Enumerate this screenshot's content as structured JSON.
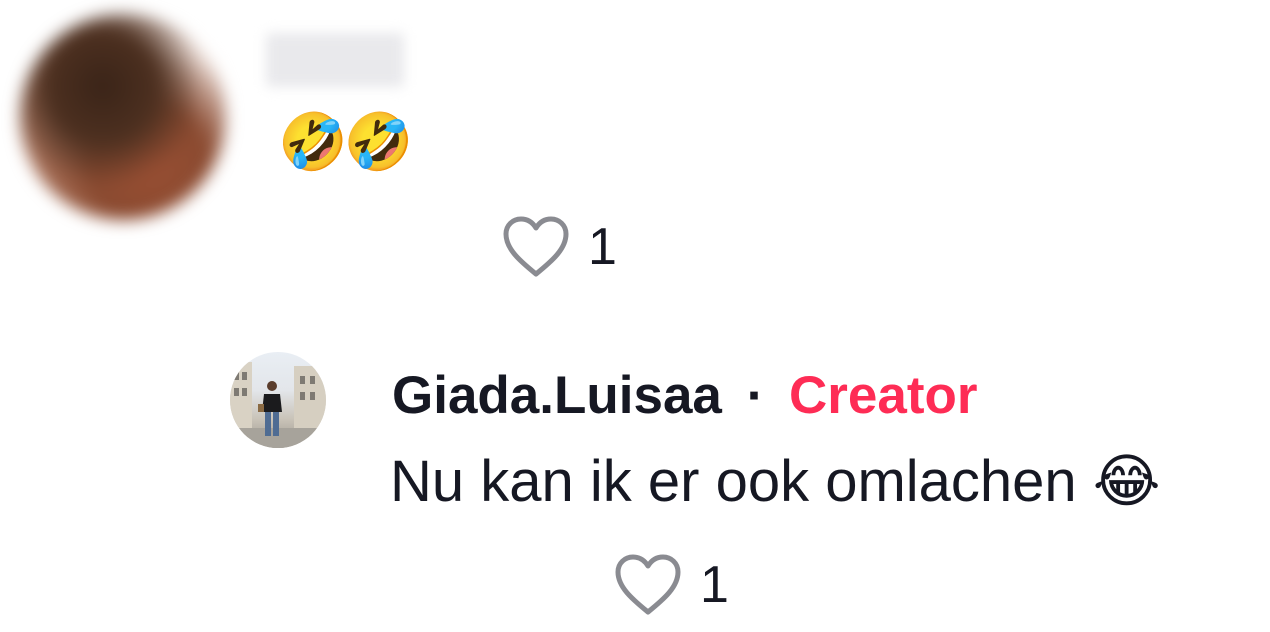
{
  "comments": [
    {
      "username": "",
      "text": "🤣🤣",
      "likes": "1",
      "like_icon": "heart-outline-icon"
    },
    {
      "username": "Giada.Luisaa",
      "separator": "·",
      "badge": "Creator",
      "badge_color": "#fe2c55",
      "text": "Nu kan ik er ook omlachen 😂",
      "likes": "1",
      "like_icon": "heart-outline-icon"
    }
  ]
}
